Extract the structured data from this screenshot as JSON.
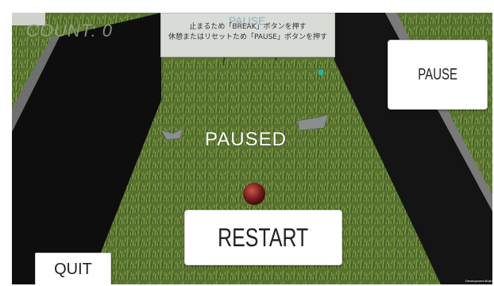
{
  "hud": {
    "count_text": "COUNT: 0"
  },
  "sign": {
    "title": "PAUSE",
    "line1": "止まるため「BREAK」ボタンを押す",
    "line2": "休憩またはリセットため「PAUSE」ボタンを押す"
  },
  "overlay": {
    "paused_label": "PAUSED"
  },
  "buttons": {
    "pause": "PAUSE",
    "restart": "RESTART",
    "quit": "QUIT"
  },
  "footer": {
    "dev_build": "Development Build"
  },
  "colors": {
    "grass": "#4f6b2b",
    "wall": "#0e0e0e",
    "ball": "#7a1e1e",
    "button_bg": "#ffffff"
  }
}
